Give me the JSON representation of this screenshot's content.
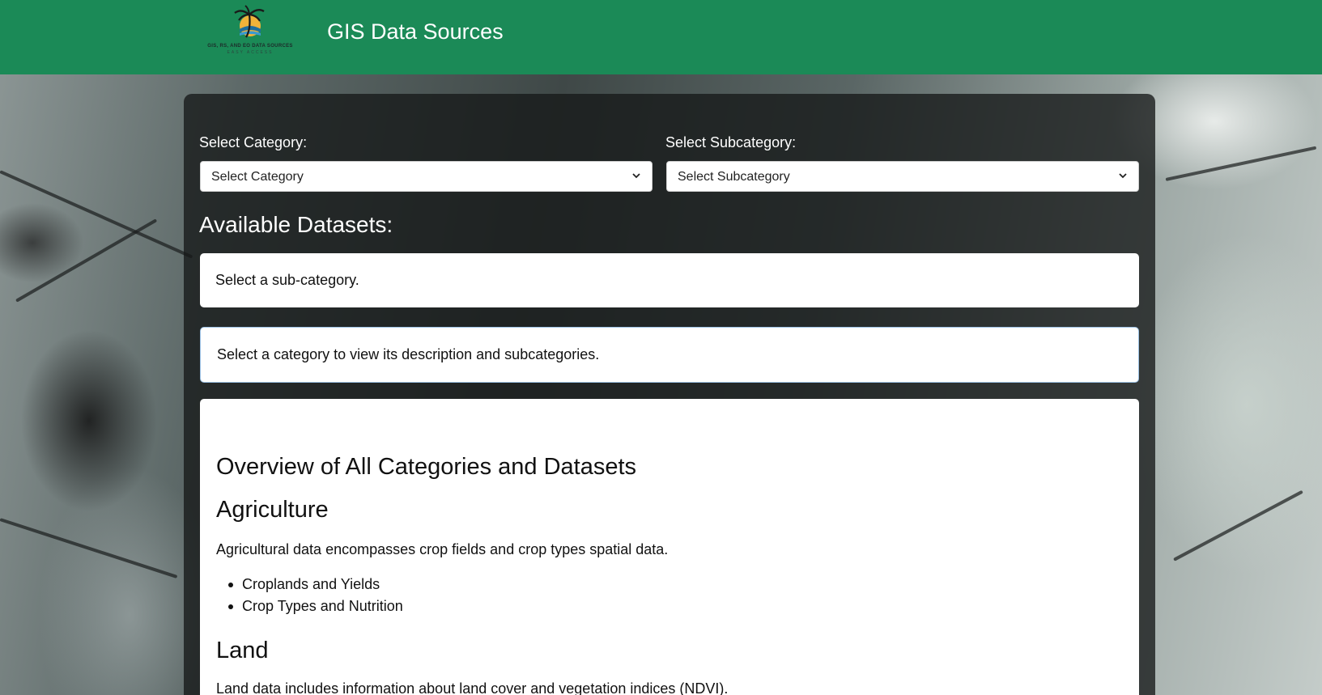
{
  "header": {
    "logo_line1": "GIS, RS, AND EO DATA SOURCES",
    "logo_line2": "EASY ACCESS",
    "title": "GIS Data Sources"
  },
  "filters": {
    "category_label": "Select Category:",
    "category_value": "Select Category",
    "subcategory_label": "Select Subcategory:",
    "subcategory_value": "Select Subcategory"
  },
  "datasets": {
    "heading": "Available Datasets:",
    "subcategory_hint": "Select a sub-category.",
    "category_hint": "Select a category to view its description and subcategories."
  },
  "overview": {
    "title": "Overview of All Categories and Datasets",
    "categories": [
      {
        "name": "Agriculture",
        "description": "Agricultural data encompasses crop fields and crop types spatial data.",
        "subcategories": [
          "Croplands and Yields",
          "Crop Types and Nutrition"
        ]
      },
      {
        "name": "Land",
        "description": "Land data includes information about land cover and vegetation indices (NDVI)."
      }
    ]
  },
  "colors": {
    "header_bg": "#1b8a57",
    "panel_bg": "rgba(22,24,24,0.78)",
    "card_bg": "#ffffff"
  },
  "icons": {
    "logo": "palm-tree-sun-logo",
    "dropdown": "chevron-down-icon"
  }
}
